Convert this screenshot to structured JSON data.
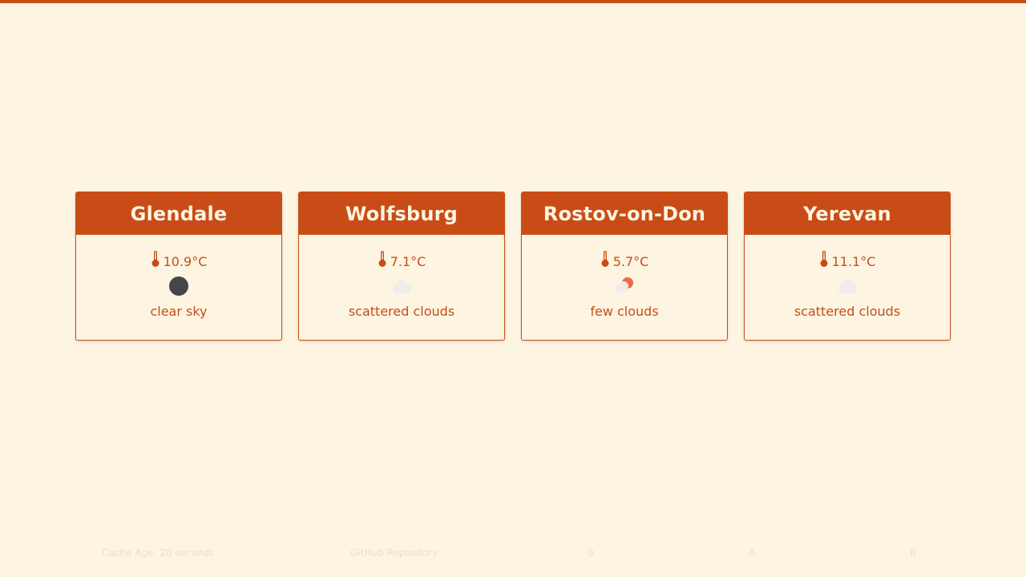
{
  "colors": {
    "accent": "#c94c16",
    "background": "#fdf5e2",
    "moon": "#45464a",
    "cloud": "#efede9",
    "sun": "#ee6a43"
  },
  "cities": [
    {
      "name": "Glendale",
      "temperature": "10.9°C",
      "icon": "clear-sky-icon",
      "description": "clear sky"
    },
    {
      "name": "Wolfsburg",
      "temperature": "7.1°C",
      "icon": "scattered-clouds-icon",
      "description": "scattered clouds"
    },
    {
      "name": "Rostov-on-Don",
      "temperature": "5.7°C",
      "icon": "few-clouds-icon",
      "description": "few clouds"
    },
    {
      "name": "Yerevan",
      "temperature": "11.1°C",
      "icon": "scattered-clouds-icon",
      "description": "scattered clouds"
    }
  ],
  "footer": {
    "cache_age": "Cache Age: 20 seconds",
    "github": "GitHub Repository",
    "item_0": "0",
    "item_a": "A",
    "item_b": "B"
  }
}
